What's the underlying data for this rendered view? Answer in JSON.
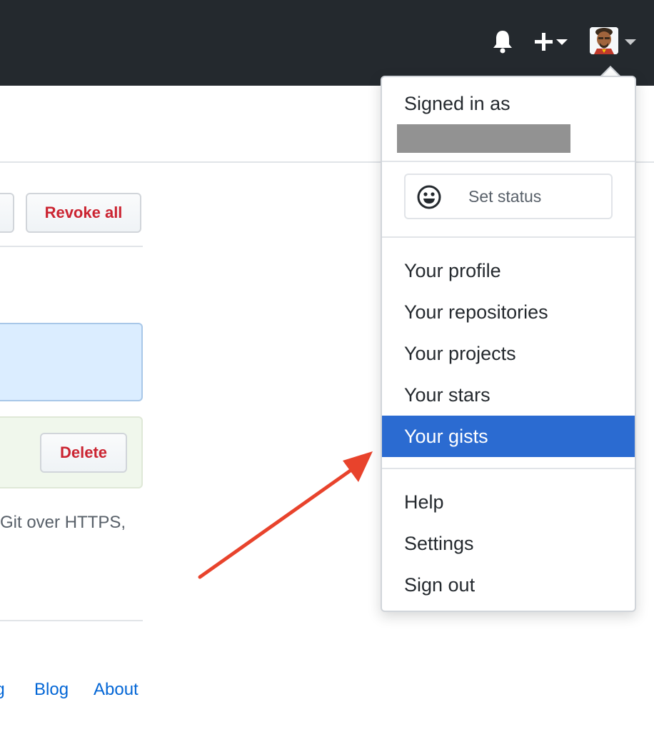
{
  "header": {
    "notification_icon": "bell-icon",
    "create_icon": "plus-icon",
    "create_caret_icon": "caret-down-icon",
    "avatar_icon": "avatar-image",
    "avatar_caret_icon": "caret-down-icon",
    "bg_color": "#24292e"
  },
  "background": {
    "revoke_all_label": "Revoke all",
    "delete_label": "Delete",
    "https_text": "Git over HTTPS,",
    "footer_cut_link": "ng",
    "footer_blog": "Blog",
    "footer_about": "About",
    "danger_color": "#cb2431",
    "link_color": "#0366d6"
  },
  "dropdown": {
    "signed_in_as": "Signed in as",
    "set_status_label": "Set status",
    "set_status_icon": "smiley-icon",
    "items_group1": [
      {
        "label": "Your profile"
      },
      {
        "label": "Your repositories"
      },
      {
        "label": "Your projects"
      },
      {
        "label": "Your stars"
      },
      {
        "label": "Your gists",
        "active": true
      }
    ],
    "items_group2": [
      {
        "label": "Help"
      },
      {
        "label": "Settings"
      },
      {
        "label": "Sign out"
      }
    ],
    "active_color": "#2b6bd1"
  },
  "annotation": {
    "arrow_icon": "red-arrow-icon",
    "arrow_color": "#e8432c"
  }
}
